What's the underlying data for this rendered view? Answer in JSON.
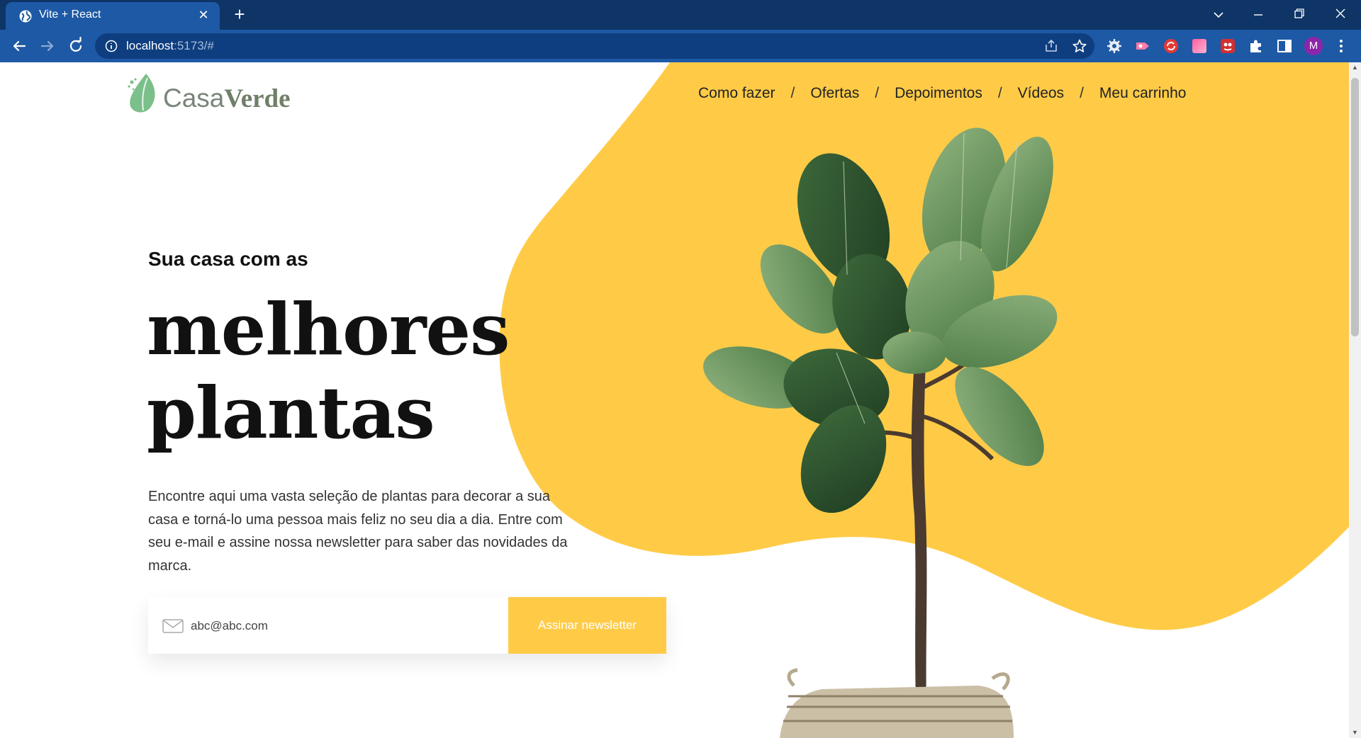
{
  "browser": {
    "tab_title": "Vite + React",
    "url_host": "localhost",
    "url_path": ":5173/#",
    "avatar_letter": "M"
  },
  "site": {
    "logo_casa": "Casa",
    "logo_verde": "Verde",
    "nav": [
      "Como fazer",
      "Ofertas",
      "Depoimentos",
      "Vídeos",
      "Meu carrinho"
    ],
    "nav_separator": "/"
  },
  "hero": {
    "subtitle": "Sua casa com as",
    "title_line1": "melhores",
    "title_line2": "plantas",
    "description": "Encontre aqui uma vasta seleção de plantas para decorar a sua casa e torná-lo uma pessoa mais feliz no seu dia a dia. Entre com seu e-mail e assine nossa newsletter para saber das novidades da marca.",
    "email_placeholder": "abc@abc.com",
    "subscribe_label": "Assinar newsletter"
  },
  "colors": {
    "accent_yellow": "#ffcb47",
    "browser_dark": "#0e3565",
    "browser_toolbar": "#1e59a5",
    "logo_green": "#6f7f68"
  },
  "icons": {
    "email": "mail-icon",
    "tab": "globe-icon",
    "extensions": [
      "gear-extension-icon",
      "video-extension-icon",
      "sync-extension-icon",
      "gradient-extension-icon",
      "red-extension-icon",
      "puzzle-icon",
      "sidepanel-icon"
    ]
  }
}
